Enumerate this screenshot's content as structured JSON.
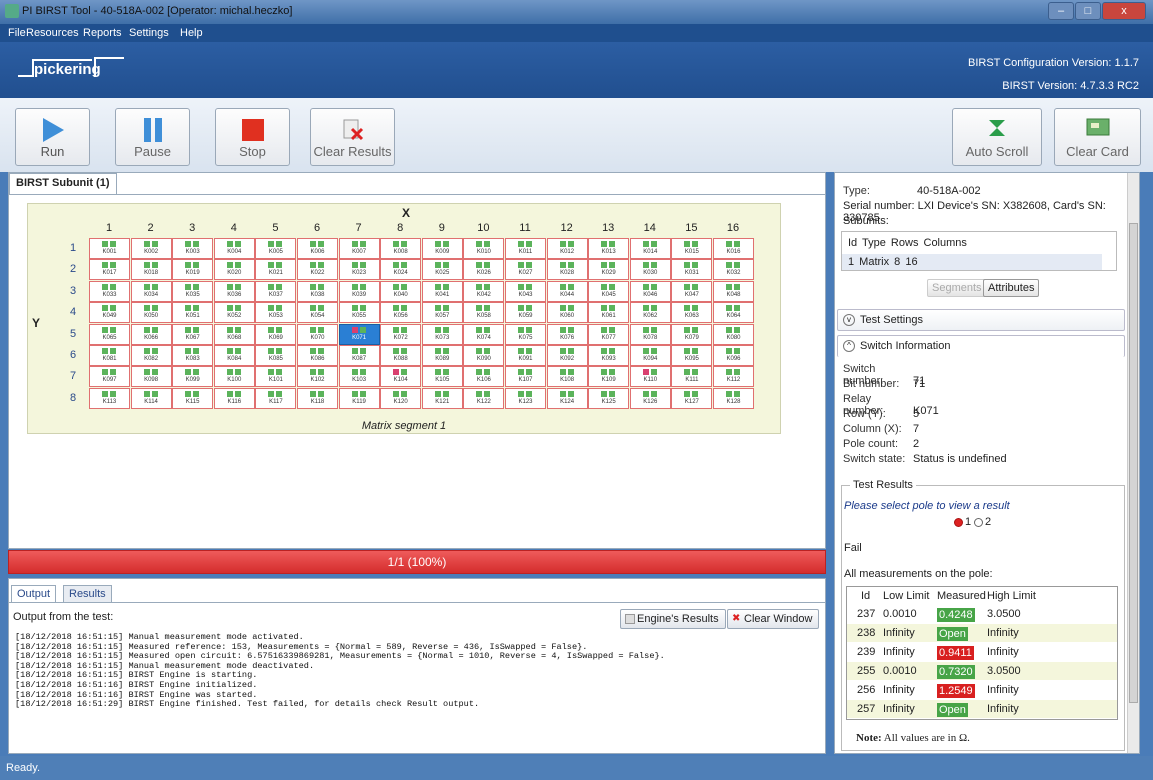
{
  "window": {
    "title": "PI BIRST Tool - 40-518A-002 [Operator: michal.heczko]",
    "minimize": "–",
    "maximize": "□",
    "close": "x"
  },
  "menu": [
    "File",
    "Resources",
    "Reports",
    "Settings",
    "Help"
  ],
  "brand": {
    "logo": "pickering",
    "config_version": "BIRST Configuration Version: 1.1.7",
    "birst_version": "BIRST Version: 4.7.3.3 RC2"
  },
  "toolbar": {
    "run": "Run",
    "pause": "Pause",
    "stop": "Stop",
    "clear_results": "Clear Results",
    "auto_scroll": "Auto Scroll",
    "clear_card": "Clear Card"
  },
  "main_tab": "BIRST Subunit (1)",
  "matrix": {
    "x_label": "X",
    "y_label": "Y",
    "segment_label": "Matrix segment 1",
    "columns": [
      "1",
      "2",
      "3",
      "4",
      "5",
      "6",
      "7",
      "8",
      "9",
      "10",
      "11",
      "12",
      "13",
      "14",
      "15",
      "16"
    ],
    "rows": [
      "1",
      "2",
      "3",
      "4",
      "5",
      "6",
      "7",
      "8"
    ],
    "selected_relay": "K071",
    "failed_relays": [
      "K071",
      "K104",
      "K110"
    ]
  },
  "progress": {
    "text": "1/1 (100%)",
    "value": 100,
    "color": "#d42c2c"
  },
  "output": {
    "tabs": [
      "Output",
      "Results"
    ],
    "label": "Output from the test:",
    "engine_results": "Engine's Results",
    "clear_window": "Clear Window",
    "log": [
      "[18/12/2018 16:51:15] Manual measurement mode activated.",
      "[18/12/2018 16:51:15] Measured reference: 153, Measurements = {Normal = 589, Reverse = 436, IsSwapped = False}.",
      "[18/12/2018 16:51:15] Measured open circuit: 6.57516339869281, Measurements = {Normal = 1010, Reverse = 4, IsSwapped = False}.",
      "[18/12/2018 16:51:15] Manual measurement mode deactivated.",
      "[18/12/2018 16:51:15] BIRST Engine is starting.",
      "[18/12/2018 16:51:16] BIRST Engine initialized.",
      "[18/12/2018 16:51:16] BIRST Engine was started.",
      "[18/12/2018 16:51:29] BIRST Engine finished. Test failed, for details check Result output."
    ]
  },
  "status": "Ready.",
  "card": {
    "type_key": "Type:",
    "type_val": "40-518A-002",
    "serial": "Serial number: LXI Device's SN: X382608, Card's SN: 330785",
    "subunits_label": "Subunits:",
    "subunit_header": "Id  Type  Rows Columns",
    "subunit_row": "1  Matrix  8     16",
    "segments": "Segments",
    "attributes": "Attributes"
  },
  "test_settings": "Test Settings",
  "switch_info": {
    "title": "Switch Information",
    "fields": [
      {
        "k": "Switch number:",
        "v": "71"
      },
      {
        "k": "Bit number:",
        "v": "71"
      },
      {
        "k": "Relay number:",
        "v": "K071"
      },
      {
        "k": "Row (Y):",
        "v": "5"
      },
      {
        "k": "Column (X):",
        "v": "7"
      },
      {
        "k": "Pole count:",
        "v": "2"
      },
      {
        "k": "Switch state:",
        "v": "Status is undefined"
      }
    ]
  },
  "test_results": {
    "legend": "Test Results",
    "hint": "Please select pole to view a result",
    "pole1": "1",
    "pole2": "2",
    "selected_pole": "1",
    "result": "Fail",
    "all_label": "All measurements on the pole:",
    "headers": [
      "Id",
      "Low Limit",
      "Measured",
      "High Limit"
    ],
    "rows": [
      {
        "id": "237",
        "low": "0.0010",
        "meas": "0.4248",
        "high": "3.0500",
        "state": "pass"
      },
      {
        "id": "238",
        "low": "Infinity",
        "meas": "Open",
        "high": "Infinity",
        "state": "pass"
      },
      {
        "id": "239",
        "low": "Infinity",
        "meas": "0.9411",
        "high": "Infinity",
        "state": "fail"
      },
      {
        "id": "255",
        "low": "0.0010",
        "meas": "0.7320",
        "high": "3.0500",
        "state": "pass"
      },
      {
        "id": "256",
        "low": "Infinity",
        "meas": "1.2549",
        "high": "Infinity",
        "state": "fail"
      },
      {
        "id": "257",
        "low": "Infinity",
        "meas": "Open",
        "high": "Infinity",
        "state": "pass"
      }
    ],
    "note_bold": "Note:",
    "note_rest": " All values are in Ω."
  }
}
